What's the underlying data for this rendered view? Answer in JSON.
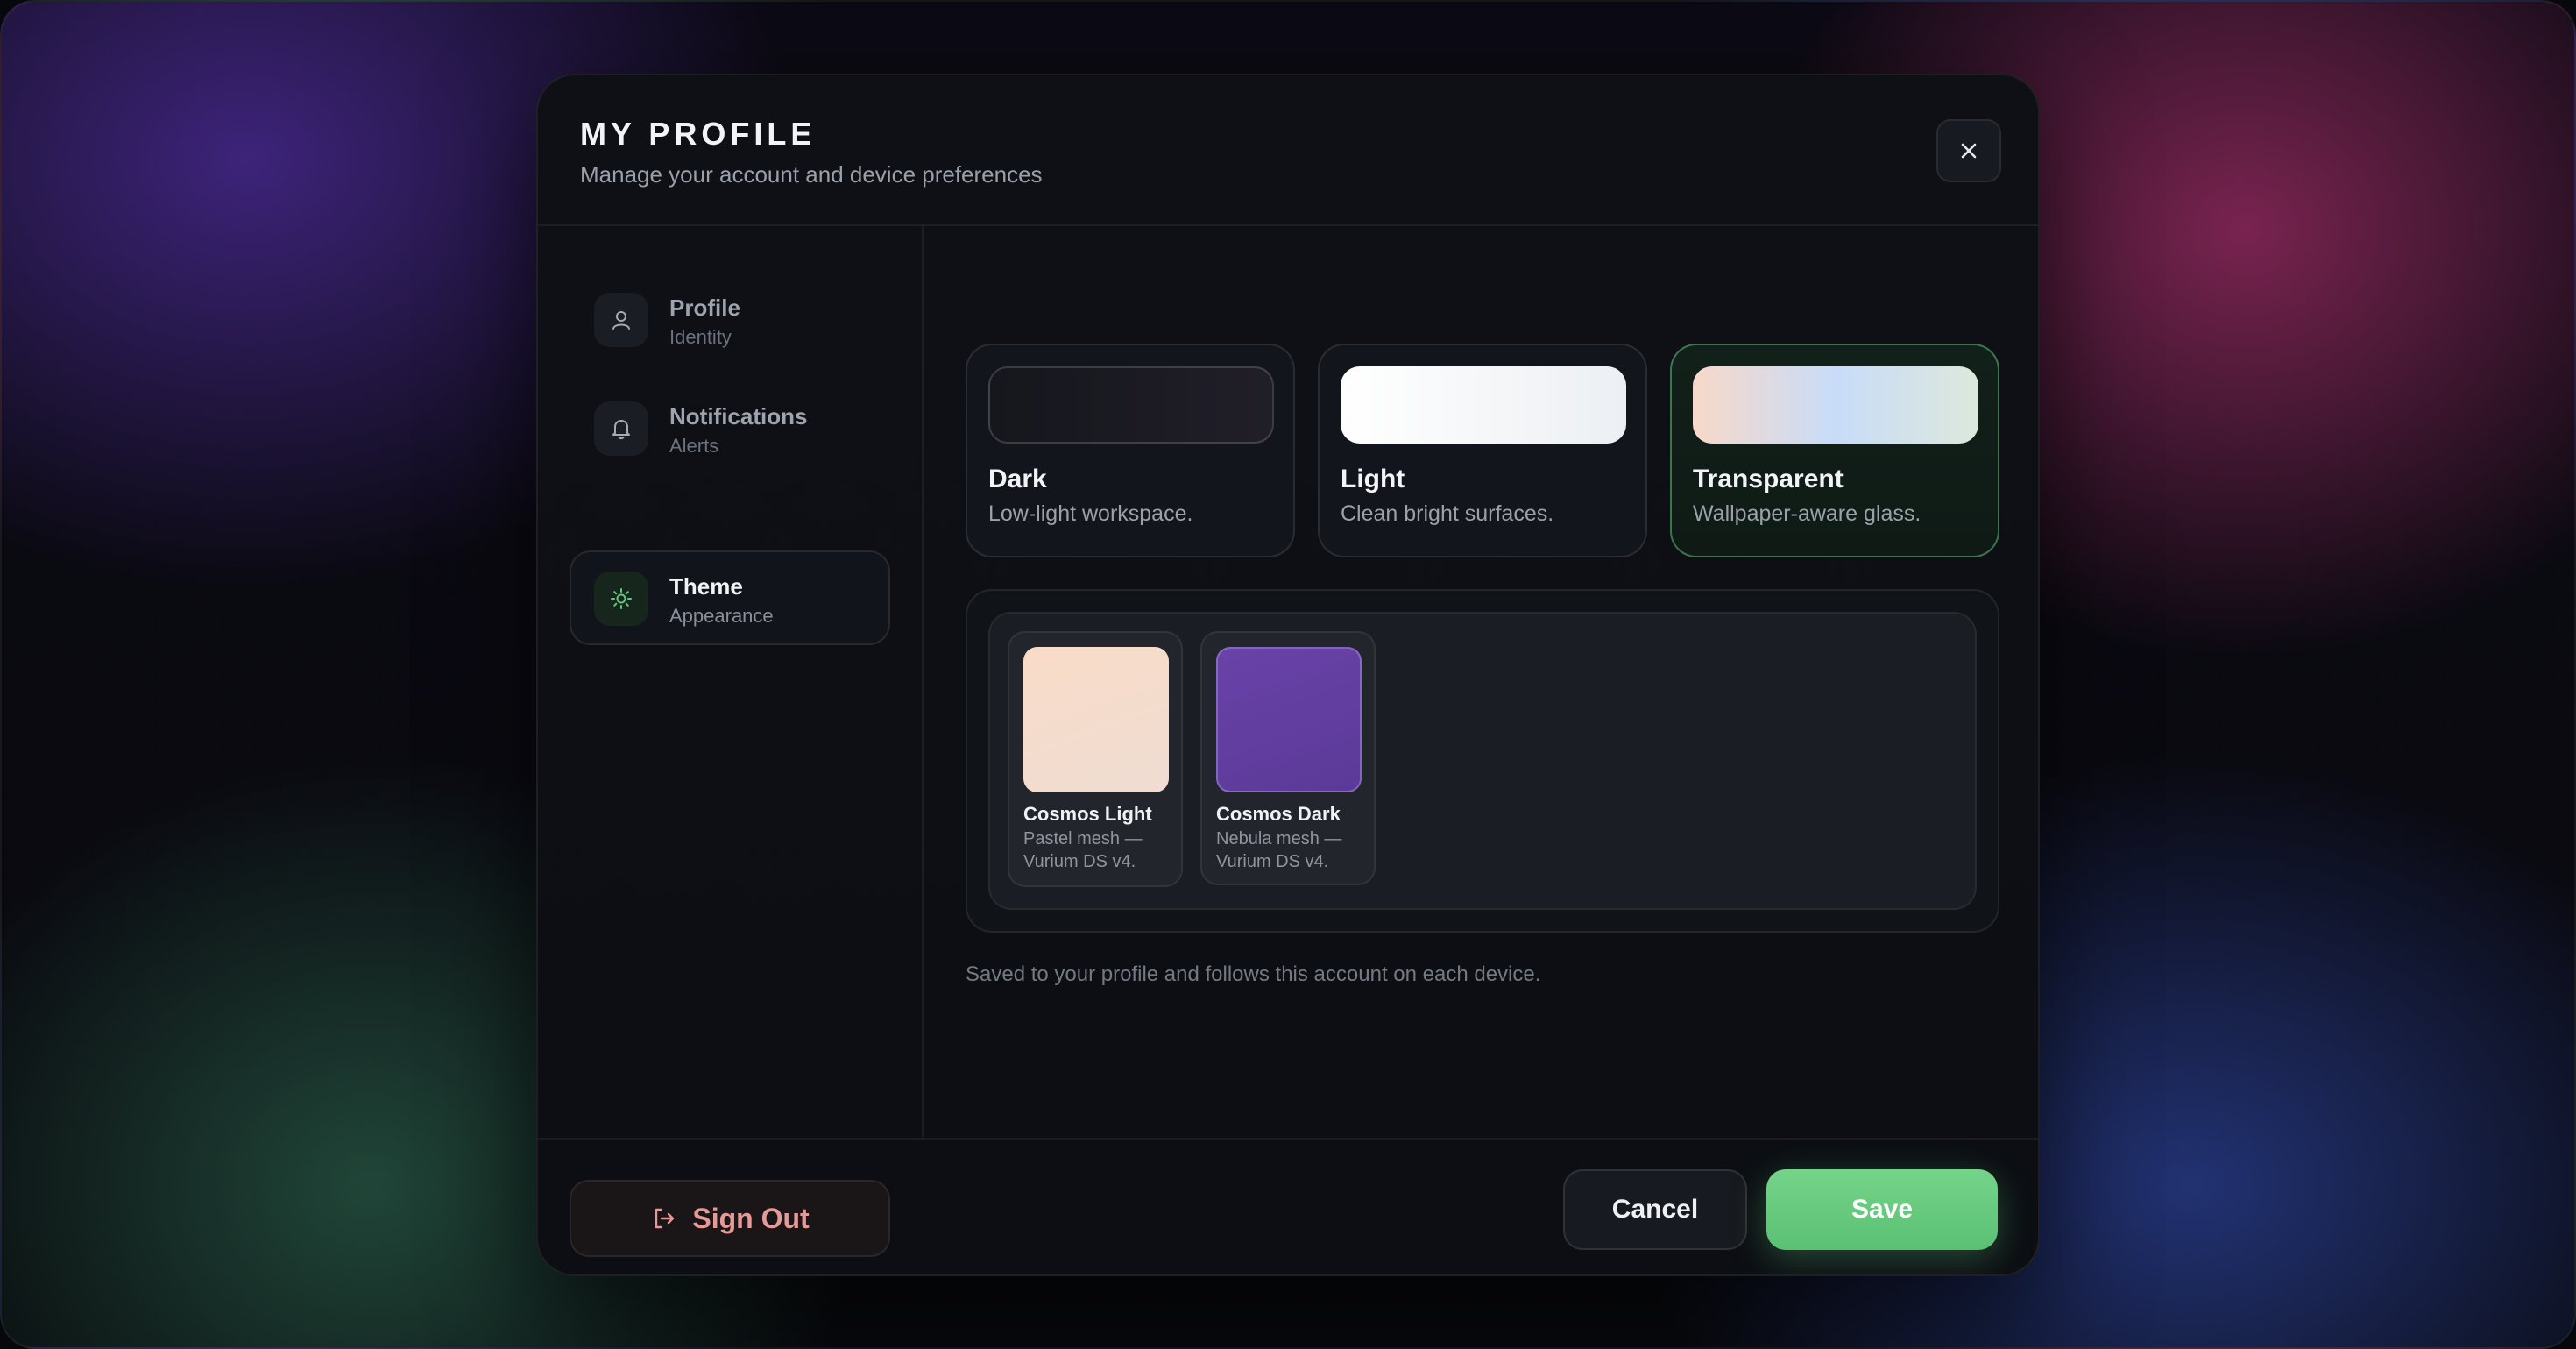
{
  "modal": {
    "title": "MY PROFILE",
    "subtitle": "Manage your account and device preferences",
    "close_icon": "close-icon"
  },
  "sidebar": {
    "items": [
      {
        "label": "Profile",
        "sub": "Identity",
        "icon": "user-icon",
        "active": false
      },
      {
        "label": "Notifications",
        "sub": "Alerts",
        "icon": "bell-icon",
        "active": false
      },
      {
        "label": "Theme",
        "sub": "Appearance",
        "icon": "sun-icon",
        "active": true
      }
    ],
    "signout_label": "Sign Out",
    "signout_icon": "sign-out-icon"
  },
  "themes": [
    {
      "name": "Dark",
      "desc": "Low-light workspace.",
      "selected": false
    },
    {
      "name": "Light",
      "desc": "Clean bright surfaces.",
      "selected": false
    },
    {
      "name": "Transparent",
      "desc": "Wallpaper-aware glass.",
      "selected": true
    }
  ],
  "wallpapers": [
    {
      "name": "Cosmos Light",
      "desc": "Pastel mesh — Vurium DS v4.",
      "color": "#f3d8c6"
    },
    {
      "name": "Cosmos Dark",
      "desc": "Nebula mesh — Vurium DS v4.",
      "color": "#5f3d9e"
    }
  ],
  "hint": "Saved to your profile and follows this account on each device.",
  "footer": {
    "cancel_label": "Cancel",
    "save_label": "Save"
  },
  "colors": {
    "accent": "#65c97d",
    "danger": "#e59a98"
  }
}
